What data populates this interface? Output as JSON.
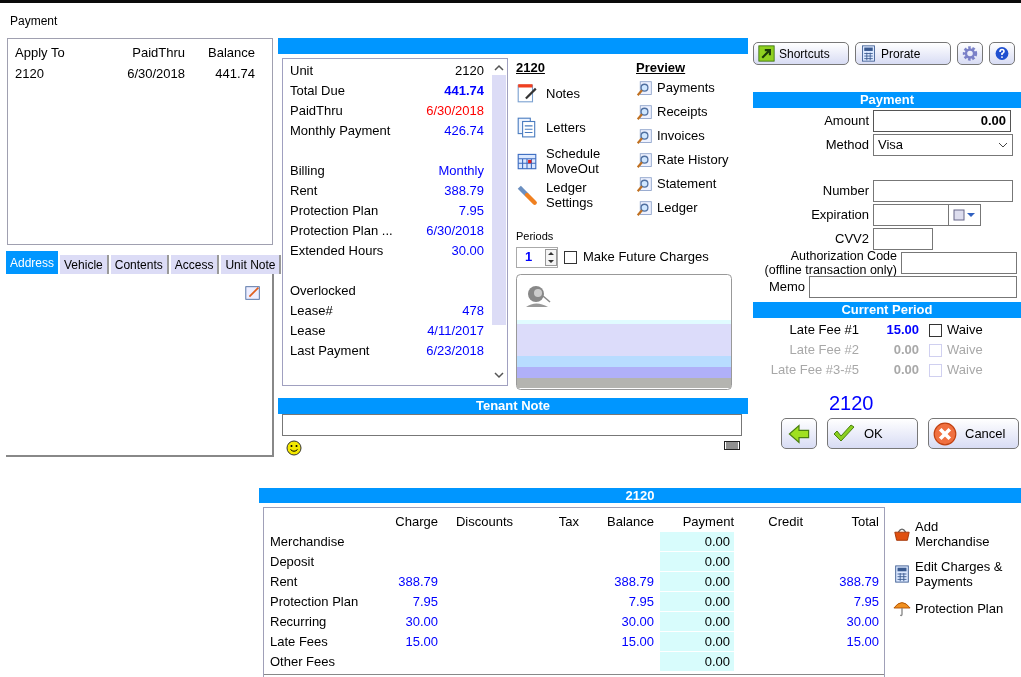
{
  "window": {
    "title": "Payment"
  },
  "apply_list": {
    "columns": [
      "Apply To",
      "PaidThru",
      "Balance"
    ],
    "rows": [
      [
        "2120",
        "6/30/2018",
        "441.74"
      ]
    ]
  },
  "tabs": [
    {
      "label": "Address",
      "selected": true
    },
    {
      "label": "Vehicle",
      "selected": false
    },
    {
      "label": "Contents",
      "selected": false
    },
    {
      "label": "Access",
      "selected": false
    },
    {
      "label": "Unit Note",
      "selected": false
    }
  ],
  "unit_info": [
    [
      {
        "label": "Unit",
        "value": "2120",
        "kind": "plain"
      },
      {
        "label": "Total Due",
        "value": "441.74",
        "kind": "total"
      },
      {
        "label": "PaidThru",
        "value": "6/30/2018",
        "kind": "alert"
      },
      {
        "label": "Monthly Payment",
        "value": "426.74",
        "kind": "info"
      }
    ],
    [
      {
        "label": "Billing",
        "value": "Monthly",
        "kind": "info"
      },
      {
        "label": "Rent",
        "value": "388.79",
        "kind": "info"
      },
      {
        "label": "Protection Plan",
        "value": "7.95",
        "kind": "info"
      },
      {
        "label": "Protection Plan ...",
        "value": "6/30/2018",
        "kind": "info"
      },
      {
        "label": "Extended Hours",
        "value": "30.00",
        "kind": "info"
      }
    ],
    [
      {
        "label": "Overlocked"
      },
      {
        "label": "Lease#",
        "value": "478",
        "kind": "info"
      },
      {
        "label": "Lease",
        "value": "4/11/2017",
        "kind": "info"
      },
      {
        "label": "Last Payment",
        "value": "6/23/2018",
        "kind": "info"
      }
    ]
  ],
  "unit_title": "2120",
  "actions": [
    {
      "label": "Notes",
      "kind": "notes"
    },
    {
      "label": "Letters",
      "kind": "letters"
    },
    {
      "label": "Schedule MoveOut",
      "kind": "calendar"
    },
    {
      "label": "Ledger Settings",
      "kind": "wrench"
    }
  ],
  "preview": {
    "title": "Preview",
    "items": [
      "Payments",
      "Receipts",
      "Invoices",
      "Rate History",
      "Statement",
      "Ledger"
    ]
  },
  "periods": {
    "label": "Periods",
    "value": "1"
  },
  "future_charges": {
    "label": "Make Future Charges",
    "checked": false
  },
  "tenant_note": {
    "title": "Tenant Note"
  },
  "toolbar": [
    {
      "label": "Shortcuts",
      "kind": "shortcut"
    },
    {
      "label": "Prorate",
      "kind": "calculator"
    },
    {
      "kind": "gear"
    },
    {
      "kind": "help"
    }
  ],
  "payment": {
    "title": "Payment",
    "fields": [
      {
        "label": "Amount",
        "value": "0.00",
        "kind": "amount"
      },
      {
        "label": "Method",
        "value": "Visa",
        "kind": "select"
      }
    ],
    "card_fields": [
      {
        "label": "Number",
        "kind": "text"
      },
      {
        "label": "Expiration",
        "kind": "date"
      },
      {
        "label": "CVV2",
        "kind": "short"
      },
      {
        "label": "Authorization Code",
        "sublabel": "(offline transaction only)",
        "kind": "auth"
      },
      {
        "label": "Memo",
        "kind": "memo"
      }
    ]
  },
  "current_period": {
    "title": "Current Period",
    "fees": [
      {
        "label": "Late Fee #1",
        "amount": "15.00",
        "waive_label": "Waive",
        "waived": false,
        "disabled": false
      },
      {
        "label": "Late Fee #2",
        "amount": "0.00",
        "waive_label": "Waive",
        "waived": false,
        "disabled": true
      },
      {
        "label": "Late Fee #3-#5",
        "amount": "0.00",
        "waive_label": "Waive",
        "waived": false,
        "disabled": true
      }
    ]
  },
  "unit_label": "2120",
  "buttons": [
    {
      "kind": "back"
    },
    {
      "kind": "ok",
      "label": "OK"
    },
    {
      "kind": "cancel",
      "label": "Cancel"
    }
  ],
  "charges": {
    "title": "2120",
    "columns": [
      {
        "label": "Charge",
        "kind": "amount"
      },
      {
        "label": "Discounts",
        "kind": "amount"
      },
      {
        "label": "Tax",
        "kind": "amount"
      },
      {
        "label": "Balance",
        "kind": "amount"
      },
      {
        "label": "Payment",
        "kind": "input"
      },
      {
        "label": "Credit",
        "kind": "amount"
      },
      {
        "label": "Total",
        "kind": "amount"
      }
    ],
    "rows": [
      {
        "label": "Merchandise",
        "payment": "0.00"
      },
      {
        "label": "Deposit",
        "payment": "0.00"
      },
      {
        "label": "Rent",
        "charge": "388.79",
        "balance": "388.79",
        "payment": "0.00",
        "total": "388.79"
      },
      {
        "label": "Protection Plan",
        "charge": "7.95",
        "balance": "7.95",
        "payment": "0.00",
        "total": "7.95"
      },
      {
        "label": "Recurring",
        "charge": "30.00",
        "balance": "30.00",
        "payment": "0.00",
        "total": "30.00"
      },
      {
        "label": "Late Fees",
        "charge": "15.00",
        "balance": "15.00",
        "payment": "0.00",
        "total": "15.00"
      },
      {
        "label": "Other Fees",
        "payment": "0.00"
      }
    ]
  },
  "side_actions": [
    {
      "label": "Add Merchandise",
      "kind": "basket"
    },
    {
      "label": "Edit Charges & Payments",
      "kind": "calculator"
    },
    {
      "label": "Protection Plan",
      "kind": "umbrella"
    }
  ]
}
